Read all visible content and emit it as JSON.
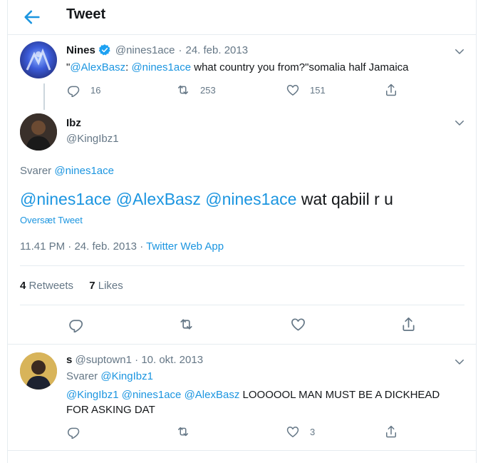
{
  "header": {
    "title": "Tweet"
  },
  "parent": {
    "name": "Nines",
    "handle": "@nines1ace",
    "sep": "·",
    "date": "24. feb. 2013",
    "text_open": "\"",
    "mention1": "@AlexBasz",
    "colon": ":",
    "mention2": "@nines1ace",
    "text_rest": "what country you from?\"somalia half Jamaica",
    "replies": "16",
    "retweets": "253",
    "likes": "151"
  },
  "main": {
    "name": "Ibz",
    "handle": "@KingIbz1",
    "replying_label": "Svarer",
    "replying_to": "@nines1ace",
    "m1": "@nines1ace",
    "m2": "@AlexBasz",
    "m3": "@nines1ace",
    "text": "wat qabiil r u",
    "translate": "Oversæt Tweet",
    "time": "11.41 PM",
    "sep": "·",
    "date": "24. feb. 2013",
    "sep2": "·",
    "source": "Twitter Web App",
    "retweet_count": "4",
    "retweet_label": "Retweets",
    "like_count": "7",
    "like_label": "Likes"
  },
  "reply": {
    "name": "s",
    "handle": "@suptown1",
    "sep": "·",
    "date": "10. okt. 2013",
    "replying_label": "Svarer",
    "replying_to": "@KingIbz1",
    "m1": "@KingIbz1",
    "m2": "@nines1ace",
    "m3": "@AlexBasz",
    "text_line1": "LOOOOOL MAN MUST BE A DICKHEAD",
    "text_line2": "FOR ASKING DAT",
    "likes": "3"
  },
  "colors": {
    "accent": "#1b95e0",
    "gray": "#657786",
    "border": "#e6ecf0"
  },
  "icons": [
    "back-arrow-icon",
    "verified-badge-icon",
    "chevron-down-icon",
    "reply-icon",
    "retweet-icon",
    "like-icon",
    "share-icon"
  ]
}
